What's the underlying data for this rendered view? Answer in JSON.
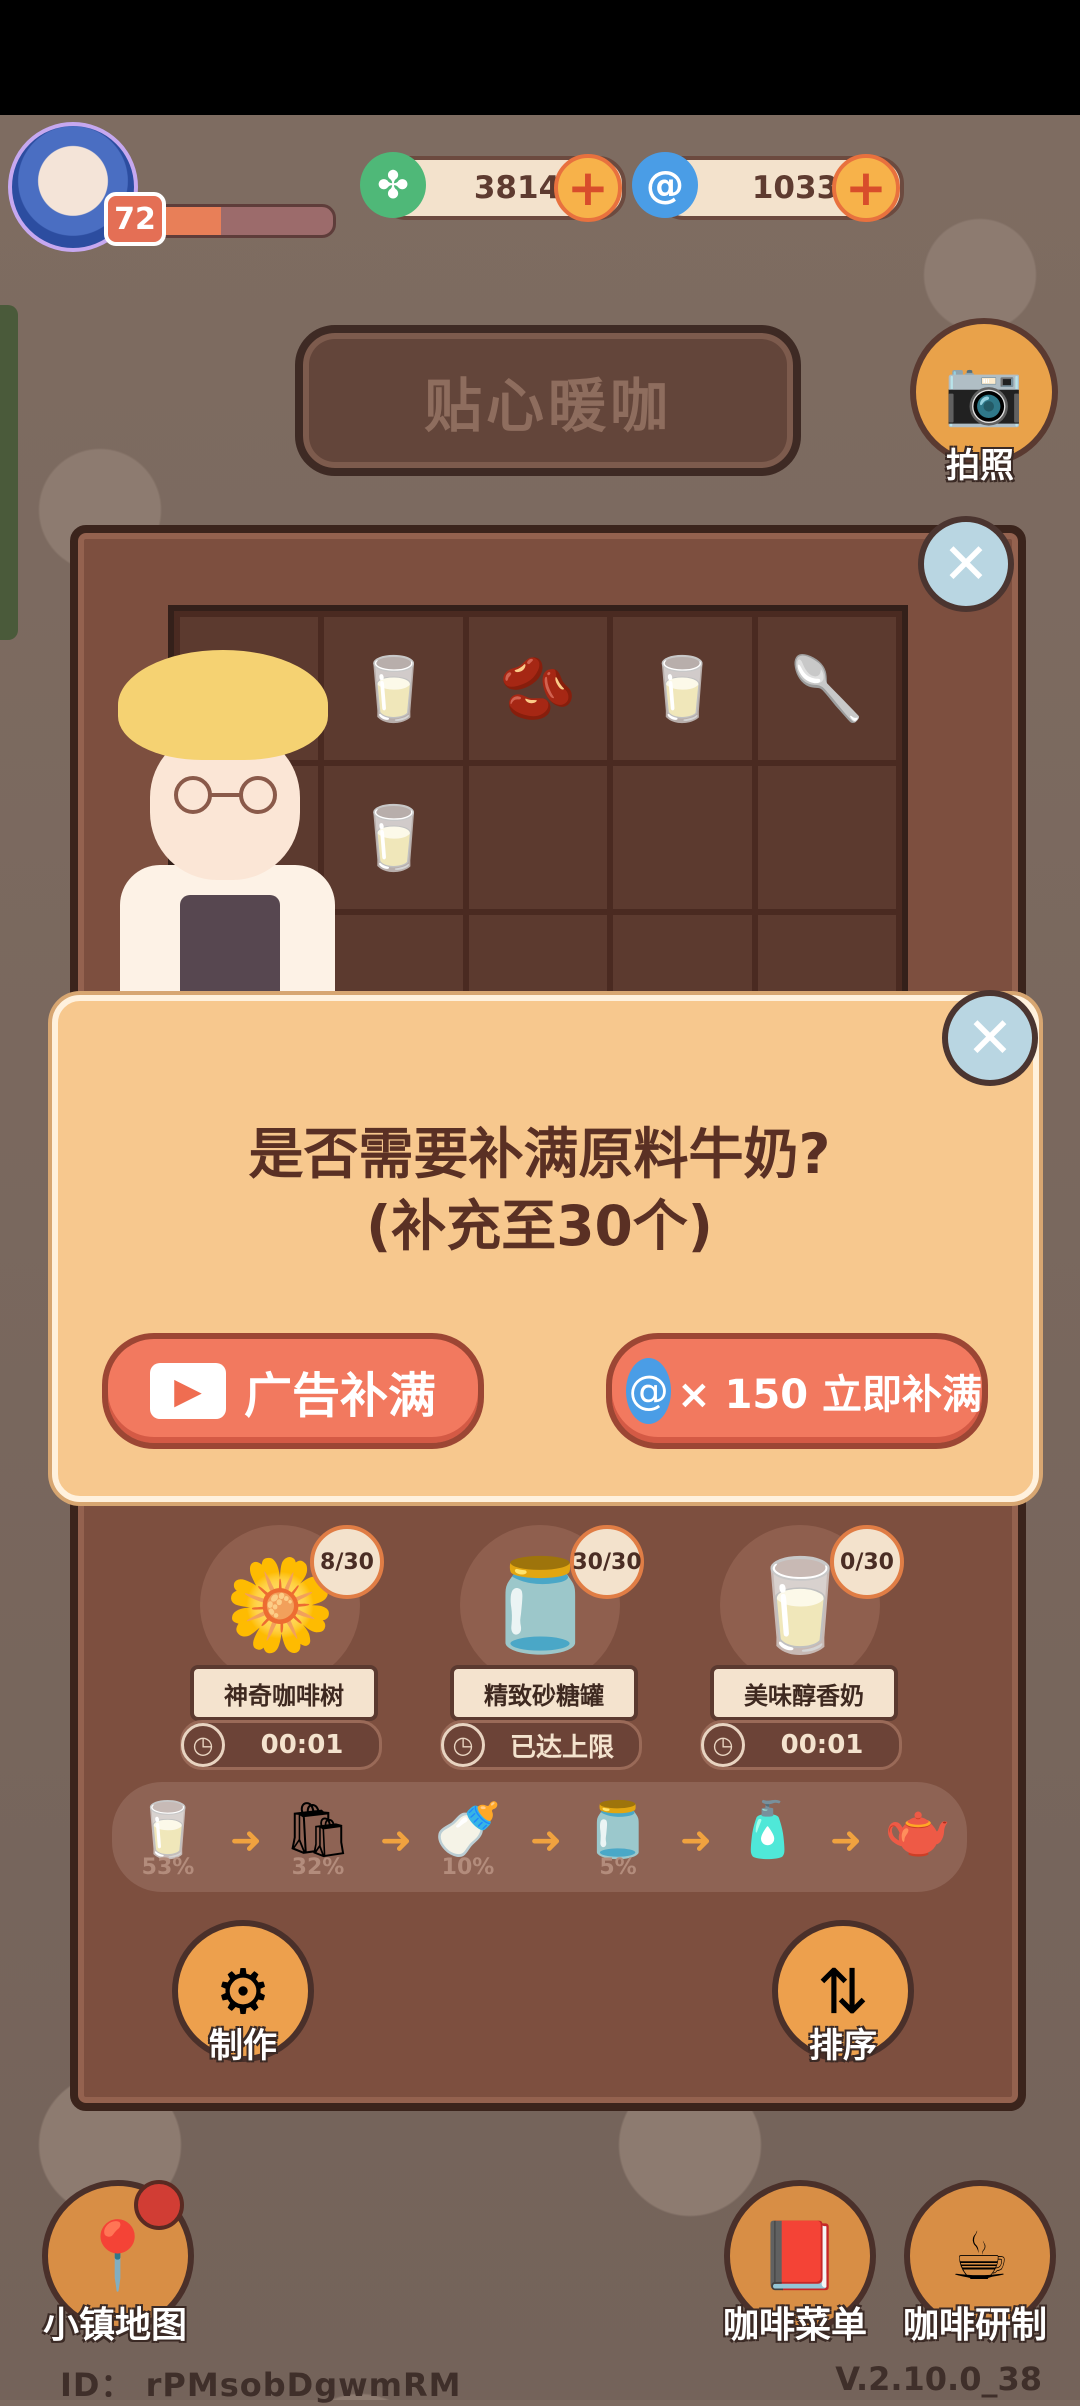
{
  "header": {
    "level": "72",
    "xp_fraction": 0.38,
    "currencies": [
      {
        "icon": "clover-icon",
        "value": "3814",
        "color": "#4fb878"
      },
      {
        "icon": "swirl-gem-icon",
        "value": "1033",
        "color": "#4a9de6"
      }
    ],
    "shop_title": "贴心暖咖",
    "camera_label": "拍照"
  },
  "grid": {
    "cells": [
      "",
      "🥛",
      "🫘",
      "🥛",
      "🥄",
      "",
      "🥛",
      "",
      "",
      "",
      "",
      "",
      "",
      "",
      ""
    ]
  },
  "dialog": {
    "line1": "是否需要补满原料牛奶?",
    "line2": "(补充至30个)",
    "ad_button_label": "广告补满",
    "buy_button_label": "× 150 立即补满",
    "close_icon": "close-icon"
  },
  "sources": [
    {
      "name": "神奇咖啡树",
      "count": "8/30",
      "timer": "00:01",
      "icon": "🌼"
    },
    {
      "name": "精致砂糖罐",
      "count": "30/30",
      "timer": "已达上限",
      "icon": "🫙"
    },
    {
      "name": "美味醇香奶",
      "count": "0/30",
      "timer": "00:01",
      "icon": "🥛"
    }
  ],
  "chain": [
    {
      "icon": "🥛",
      "pct": "53%"
    },
    {
      "icon": "🛍",
      "pct": "32%"
    },
    {
      "icon": "🍼",
      "pct": "10%"
    },
    {
      "icon": "🫙",
      "pct": "5%"
    },
    {
      "icon": "🧴",
      "pct": ""
    },
    {
      "icon": "🫖",
      "pct": ""
    }
  ],
  "actions": {
    "make_label": "制作",
    "sort_label": "排序"
  },
  "bottom": {
    "map_label": "小镇地图",
    "menu_label": "咖啡菜单",
    "research_label": "咖啡研制"
  },
  "footer": {
    "id_text": "ID： rPMsobDgwmRM",
    "version": "V.2.10.0_38"
  }
}
